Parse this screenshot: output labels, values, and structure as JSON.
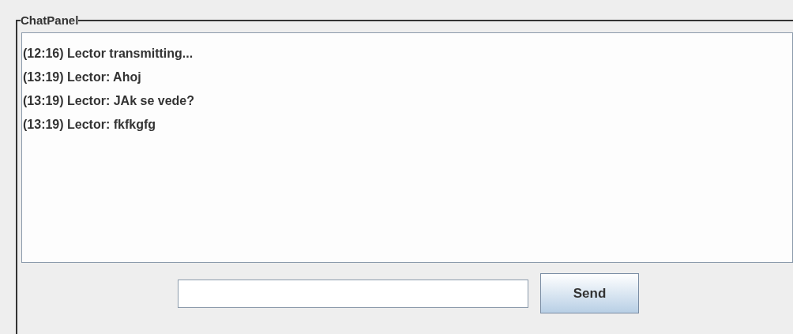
{
  "panel": {
    "title": "ChatPanel"
  },
  "messages": [
    {
      "text": "(12:16) Lector transmitting..."
    },
    {
      "text": "(13:19) Lector: Ahoj"
    },
    {
      "text": "(13:19) Lector: JAk se vede?"
    },
    {
      "text": "(13:19) Lector: fkfkgfg"
    }
  ],
  "send_button": {
    "label": "Send"
  }
}
